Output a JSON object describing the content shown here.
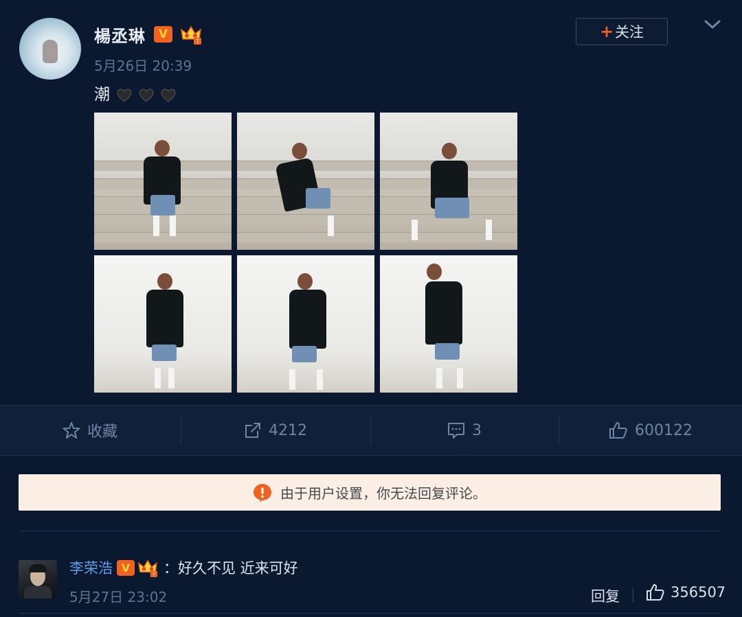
{
  "post": {
    "username": "楊丞琳",
    "verified_badge": "V",
    "time": "5月26日 20:39",
    "text": "潮",
    "follow_button": {
      "plus": "+",
      "label": "关注"
    },
    "photos": [
      {
        "scene": "stairs"
      },
      {
        "scene": "stairs"
      },
      {
        "scene": "stairs"
      },
      {
        "scene": "wall"
      },
      {
        "scene": "wall"
      },
      {
        "scene": "wall"
      }
    ]
  },
  "actions": {
    "favorite": {
      "label": "收藏",
      "icon": "star-icon"
    },
    "repost": {
      "count": "4212",
      "icon": "share-icon"
    },
    "comment": {
      "count": "3",
      "icon": "comment-icon"
    },
    "like": {
      "count": "600122",
      "icon": "thumbs-up-icon"
    }
  },
  "notice": {
    "text": "由于用户设置，你无法回复评论。",
    "icon": "warning-icon"
  },
  "comment": {
    "username": "李荣浩",
    "verified_badge": "V",
    "text": "：好久不见 近来可好",
    "time": "5月27日 23:02",
    "reply_label": "回复",
    "like_count": "356507"
  },
  "colors": {
    "background": "#0b1930",
    "accent_orange": "#f0621f",
    "link_blue": "#5e9ee8",
    "muted_text": "#5f7393",
    "notice_bg": "#fbeee4"
  }
}
